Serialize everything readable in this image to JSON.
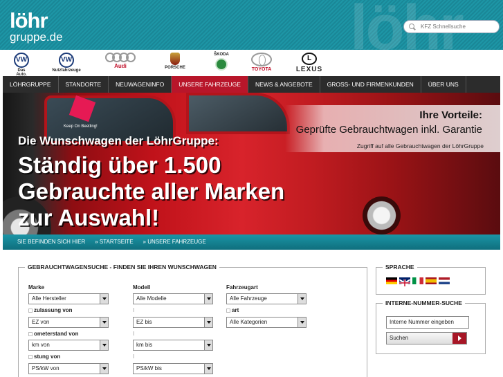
{
  "header": {
    "logo_line1": "löhr",
    "logo_line2": "gruppe.de",
    "watermark": "löhr",
    "search_placeholder": "KFZ Schnellsuche"
  },
  "brands": [
    {
      "name": "vw",
      "mark": "VW",
      "caption": "Das Auto."
    },
    {
      "name": "vw-nutzfahrzeuge",
      "mark": "VW",
      "caption": "Nutzfahrzeuge"
    },
    {
      "name": "audi",
      "caption": "Audi"
    },
    {
      "name": "porsche",
      "caption": "PORSCHE"
    },
    {
      "name": "skoda",
      "caption": "ŠKODA"
    },
    {
      "name": "toyota",
      "caption": "TOYOTA"
    },
    {
      "name": "lexus",
      "mark": "L",
      "caption": "LEXUS"
    }
  ],
  "nav": {
    "items": [
      "LÖHRGRUPPE",
      "STANDORTE",
      "NEUWAGENINFO",
      "UNSERE FAHRZEUGE",
      "NEWS & ANGEBOTE",
      "GROSS- UND FIRMENKUNDEN",
      "ÜBER UNS"
    ],
    "active_index": 3
  },
  "hero": {
    "sticker": "Keep On Beetling!",
    "vorteile_title": "Ihre Vorteile:",
    "vorteile_sub": "Geprüfte Gebrauchtwagen inkl. Garantie",
    "vorteile_small": "Zugriff auf alle Gebrauchtwagen der LöhrGruppe",
    "headline_1": "Die Wunschwagen der LöhrGruppe:",
    "headline_2": "Ständig über 1.500",
    "headline_3": "Gebrauchte aller Marken",
    "headline_4": "zur Auswahl!"
  },
  "breadcrumb": {
    "label": "SIE BEFINDEN SICH HIER",
    "items": [
      "» STARTSEITE",
      "» UNSERE FAHRZEUGE"
    ]
  },
  "used_search": {
    "title": "GEBRAUCHTWAGENSUCHE - FINDEN SIE IHREN WUNSCHWAGEN",
    "marke_label": "Marke",
    "marke_value": "Alle Hersteller",
    "modell_label": "Modell",
    "modell_value": "Alle Modelle",
    "fahrzeugart_label": "Fahrzeugart",
    "fahrzeugart_value": "Alle Fahrzeuge",
    "ez_label": "zulassung von",
    "ez_from": "EZ von",
    "ez_to": "EZ bis",
    "bauart_label": "art",
    "bauart_value": "Alle Kategorien",
    "km_label": "ometerstand von",
    "km_from": "km von",
    "km_to": "km bis",
    "ps_label": "stung von",
    "ps_from": "PS/kW von",
    "ps_to": "PS/kW bis",
    "bis_marker": "I"
  },
  "sprache": {
    "title": "SPRACHE",
    "flags": [
      {
        "name": "german",
        "colors": [
          "#000000",
          "#dd0000",
          "#ffce00"
        ]
      },
      {
        "name": "english",
        "colors": [
          "#012169",
          "#ffffff",
          "#c8102e"
        ]
      },
      {
        "name": "italian",
        "colors": [
          "#009246",
          "#ffffff",
          "#ce2b37"
        ]
      },
      {
        "name": "spanish",
        "colors": [
          "#aa151b",
          "#f1bf00",
          "#aa151b"
        ]
      },
      {
        "name": "dutch",
        "colors": [
          "#ae1c28",
          "#ffffff",
          "#21468b"
        ]
      }
    ]
  },
  "internal_search": {
    "title": "INTERNE-NUMMER-SUCHE",
    "input_value": "Interne Nummer eingeben",
    "button_label": "Suchen"
  }
}
